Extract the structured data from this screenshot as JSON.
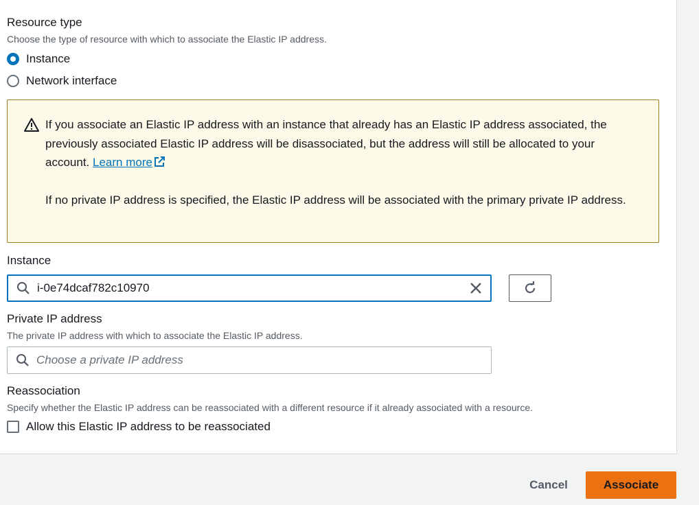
{
  "resource_type": {
    "label": "Resource type",
    "description": "Choose the type of resource with which to associate the Elastic IP address.",
    "options": [
      {
        "label": "Instance",
        "selected": true
      },
      {
        "label": "Network interface",
        "selected": false
      }
    ]
  },
  "alert": {
    "icon": "warning-icon",
    "paragraph1": "If you associate an Elastic IP address with an instance that already has an Elastic IP address associated, the previously associated Elastic IP address will be disassociated, but the address will still be allocated to your account.",
    "link_label": "Learn more",
    "paragraph2": "If no private IP address is specified, the Elastic IP address will be associated with the primary private IP address."
  },
  "instance": {
    "label": "Instance",
    "value": "i-0e74dcaf782c10970"
  },
  "private_ip": {
    "label": "Private IP address",
    "description": "The private IP address with which to associate the Elastic IP address.",
    "placeholder": "Choose a private IP address"
  },
  "reassociation": {
    "label": "Reassociation",
    "description": "Specify whether the Elastic IP address can be reassociated with a different resource if it already associated with a resource.",
    "checkbox_label": "Allow this Elastic IP address to be reassociated",
    "checked": false
  },
  "footer": {
    "cancel_label": "Cancel",
    "associate_label": "Associate"
  },
  "colors": {
    "accent": "#0073bb",
    "primary_button": "#ec7211",
    "alert_background": "#fdfae9",
    "alert_border": "#9b7f1f"
  }
}
